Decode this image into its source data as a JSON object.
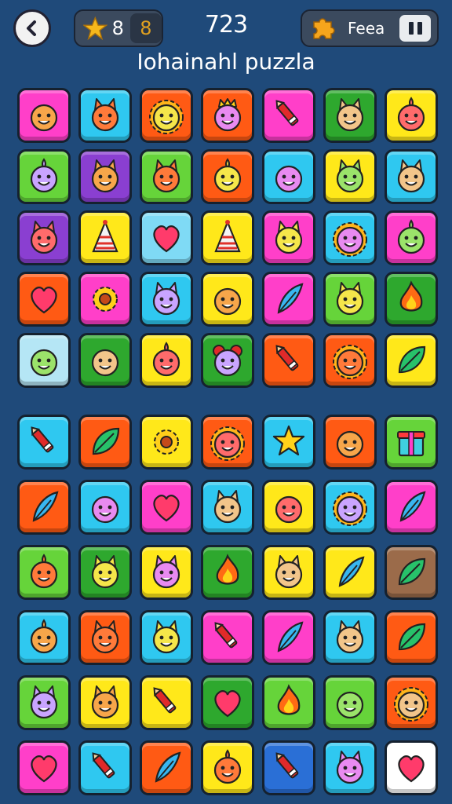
{
  "header": {
    "stars_value": "8",
    "badge_value": "8",
    "moves_value": "723",
    "feature_label": "Feea",
    "title": "Iohainahl puzzla"
  },
  "board_top": {
    "rows": [
      [
        {
          "color": "#ff3fc9",
          "icon": "ghost-face-icon"
        },
        {
          "color": "#2fc8f0",
          "icon": "cat-face-icon"
        },
        {
          "color": "#ff5a14",
          "icon": "sun-face-icon"
        },
        {
          "color": "#ff5a14",
          "icon": "crowned-face-icon"
        },
        {
          "color": "#ff3fc9",
          "icon": "crayon-icon"
        },
        {
          "color": "#2ea82e",
          "icon": "devil-face-icon"
        },
        {
          "color": "#ffe81a",
          "icon": "alien-face-icon"
        }
      ],
      [
        {
          "color": "#66d43a",
          "icon": "onion-face-icon"
        },
        {
          "color": "#8a3fd1",
          "icon": "devil-face-icon"
        },
        {
          "color": "#66d43a",
          "icon": "cat-face-icon"
        },
        {
          "color": "#ff5a14",
          "icon": "blob-face-icon"
        },
        {
          "color": "#2fc8f0",
          "icon": "smiley-face-icon"
        },
        {
          "color": "#ffe81a",
          "icon": "wolf-face-icon"
        },
        {
          "color": "#2fc8f0",
          "icon": "goblin-face-icon"
        }
      ],
      [
        {
          "color": "#8a3fd1",
          "icon": "cat-face-icon"
        },
        {
          "color": "#ffe81a",
          "icon": "party-hat-icon"
        },
        {
          "color": "#7fdaf5",
          "icon": "heart-icon"
        },
        {
          "color": "#ffe81a",
          "icon": "party-hat-icon"
        },
        {
          "color": "#ff3fc9",
          "icon": "cat-face-icon"
        },
        {
          "color": "#2fc8f0",
          "icon": "lion-face-icon"
        },
        {
          "color": "#ff3fc9",
          "icon": "blob-face-icon"
        }
      ],
      [
        {
          "color": "#ff5a14",
          "icon": "heart-icon"
        },
        {
          "color": "#ff3fc9",
          "icon": "sunflower-icon"
        },
        {
          "color": "#2fc8f0",
          "icon": "cat-face-icon"
        },
        {
          "color": "#ffe81a",
          "icon": "kid-face-icon"
        },
        {
          "color": "#ff3fc9",
          "icon": "feather-icon"
        },
        {
          "color": "#66d43a",
          "icon": "cat-face-icon"
        },
        {
          "color": "#2ea82e",
          "icon": "flame-icon"
        }
      ],
      [
        {
          "color": "#b5e6f5",
          "icon": "kid-face-icon"
        },
        {
          "color": "#2ea82e",
          "icon": "bald-face-icon"
        },
        {
          "color": "#ffe81a",
          "icon": "alien-face-icon"
        },
        {
          "color": "#2ea82e",
          "icon": "clown-face-icon"
        },
        {
          "color": "#ff5a14",
          "icon": "crayon-icon"
        },
        {
          "color": "#ff5a14",
          "icon": "sun-face-icon"
        },
        {
          "color": "#ffe81a",
          "icon": "leaf-icon"
        }
      ]
    ]
  },
  "board_bottom": {
    "rows": [
      [
        {
          "color": "#2fc8f0",
          "icon": "crayon-icon"
        },
        {
          "color": "#ff5a14",
          "icon": "leaf-icon"
        },
        {
          "color": "#ffe81a",
          "icon": "sunflower-icon"
        },
        {
          "color": "#ff5a14",
          "icon": "sun-face-icon"
        },
        {
          "color": "#2fc8f0",
          "icon": "star-icon"
        },
        {
          "color": "#ff5a14",
          "icon": "kid-face-icon"
        },
        {
          "color": "#66d43a",
          "icon": "gift-icon"
        }
      ],
      [
        {
          "color": "#ff5a14",
          "icon": "feather-icon"
        },
        {
          "color": "#2fc8f0",
          "icon": "ghost-face-icon"
        },
        {
          "color": "#ff3fc9",
          "icon": "heart-icon"
        },
        {
          "color": "#2fc8f0",
          "icon": "devil-face-icon"
        },
        {
          "color": "#ffe81a",
          "icon": "smiley-face-icon"
        },
        {
          "color": "#2fc8f0",
          "icon": "lion-face-icon"
        },
        {
          "color": "#ff3fc9",
          "icon": "feather-icon"
        }
      ],
      [
        {
          "color": "#66d43a",
          "icon": "onion-face-icon"
        },
        {
          "color": "#2ea82e",
          "icon": "cat-face-icon"
        },
        {
          "color": "#ffe81a",
          "icon": "devil-face-icon"
        },
        {
          "color": "#2ea82e",
          "icon": "flame-icon"
        },
        {
          "color": "#ffe81a",
          "icon": "devil-face-icon"
        },
        {
          "color": "#ffe81a",
          "icon": "feather-icon"
        },
        {
          "color": "#9b6b4a",
          "icon": "leaf-icon"
        }
      ],
      [
        {
          "color": "#2fc8f0",
          "icon": "alien-face-icon"
        },
        {
          "color": "#ff5a14",
          "icon": "cat-face-icon"
        },
        {
          "color": "#2fc8f0",
          "icon": "goblin-face-icon"
        },
        {
          "color": "#ff3fc9",
          "icon": "crayon-icon"
        },
        {
          "color": "#ff3fc9",
          "icon": "feather-icon"
        },
        {
          "color": "#2fc8f0",
          "icon": "goblin-face-icon"
        },
        {
          "color": "#ff5a14",
          "icon": "leaf-icon"
        }
      ],
      [
        {
          "color": "#66d43a",
          "icon": "cat-face-icon"
        },
        {
          "color": "#ffe81a",
          "icon": "devil-face-icon"
        },
        {
          "color": "#ffe81a",
          "icon": "crayon-icon"
        },
        {
          "color": "#2ea82e",
          "icon": "heart-icon"
        },
        {
          "color": "#66d43a",
          "icon": "flame-icon"
        },
        {
          "color": "#66d43a",
          "icon": "kid-face-icon"
        },
        {
          "color": "#ff5a14",
          "icon": "sun-face-icon"
        }
      ],
      [
        {
          "color": "#ff3fc9",
          "icon": "heart-icon"
        },
        {
          "color": "#2fc8f0",
          "icon": "crayon-icon"
        },
        {
          "color": "#ff5a14",
          "icon": "feather-icon"
        },
        {
          "color": "#ffe81a",
          "icon": "blob-face-icon"
        },
        {
          "color": "#2a6fd6",
          "icon": "crayon-icon"
        },
        {
          "color": "#2fc8f0",
          "icon": "cat-face-icon"
        },
        {
          "color": "#ffffff",
          "icon": "heart-icon"
        }
      ]
    ]
  }
}
